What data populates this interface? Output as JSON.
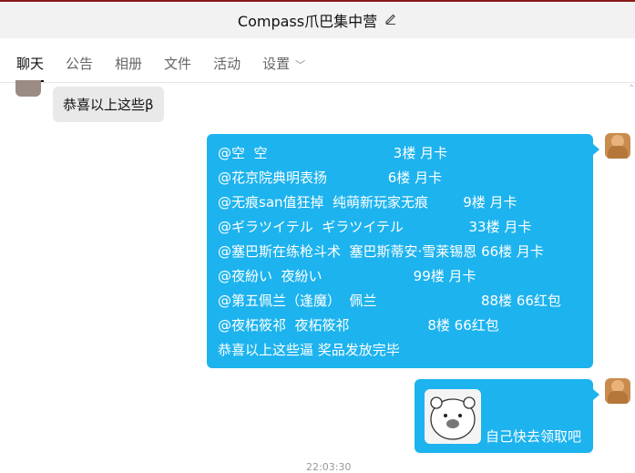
{
  "window": {
    "title": "Compass爪巴集中营"
  },
  "tabs": [
    {
      "label": "聊天",
      "active": true
    },
    {
      "label": "公告"
    },
    {
      "label": "相册"
    },
    {
      "label": "文件"
    },
    {
      "label": "活动"
    },
    {
      "label": "设置"
    }
  ],
  "messages": {
    "incoming_text": "恭喜以上这些β",
    "announcement_lines": [
      "@空  空                             3楼 月卡",
      "@花京院典明表扬              6楼 月卡",
      "@无痕san值狂掉  纯萌新玩家无痕        9楼 月卡",
      "@ギラツイテル  ギラツイテル               33楼 月卡",
      "@塞巴斯在练枪斗术  塞巴斯蒂安·雪莱锡恩 66楼 月卡",
      "@夜紛い  夜紛い                     99楼 月卡",
      "@第五佩兰（逢魔）  佩兰                        88楼 66红包",
      "@夜柘筱祁  夜柘筱祁                  8楼 66红包",
      "恭喜以上这些逼 奖品发放完毕"
    ],
    "last_text": "自己快去领取吧",
    "timestamp": "22:03:30"
  },
  "colors": {
    "bubble_blue": "#1db3ee",
    "title_bar": "#f2f2f2"
  },
  "icons": {
    "edit": "pencil-icon",
    "settings_dropdown": "chevron-down-icon"
  }
}
